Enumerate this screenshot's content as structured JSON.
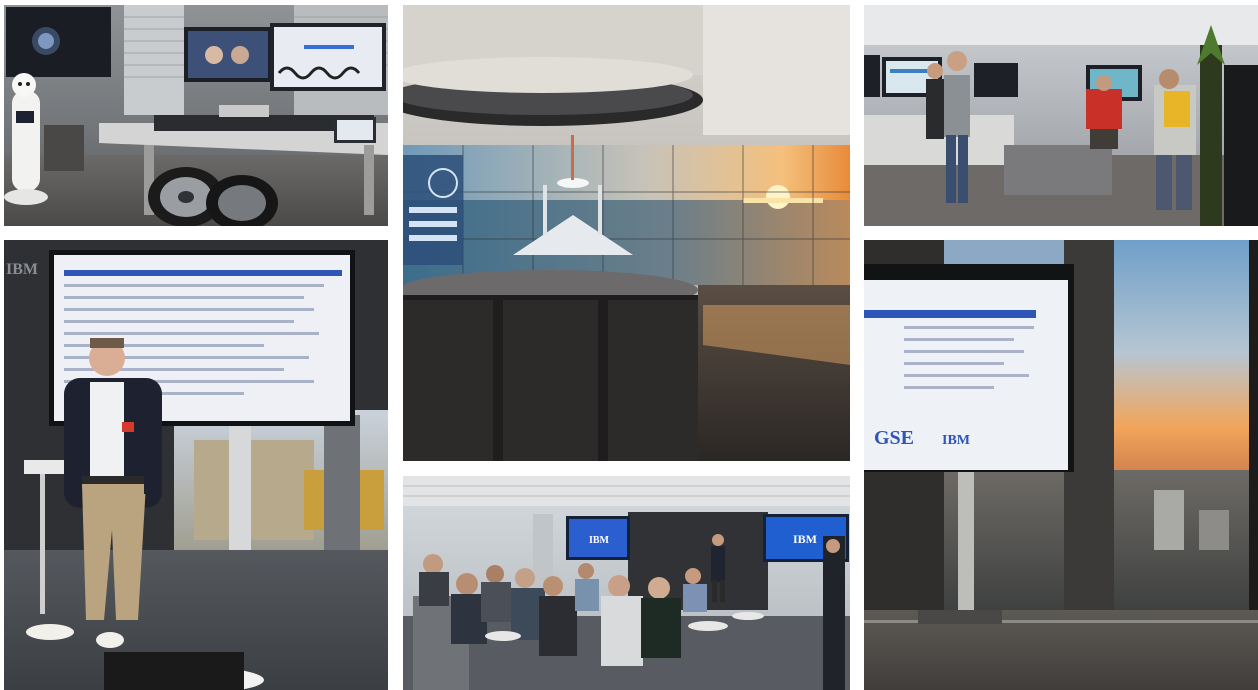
{
  "photos": [
    {
      "id": "photo-tech-lab"
    },
    {
      "id": "photo-video-wall"
    },
    {
      "id": "photo-visitors-demo"
    },
    {
      "id": "photo-speaker"
    },
    {
      "id": "photo-audience"
    },
    {
      "id": "photo-city-sunset"
    }
  ],
  "brands": {
    "ibm": "IBM",
    "guide_logo_letters": "GSE"
  },
  "colors": {
    "ibm_blue": "#1f5fd0",
    "slide_header_blue": "#2f55b8",
    "slide_bg": "#eef0f6",
    "sky_sunset": "#f2a55a",
    "sea": "#4f7f99"
  }
}
